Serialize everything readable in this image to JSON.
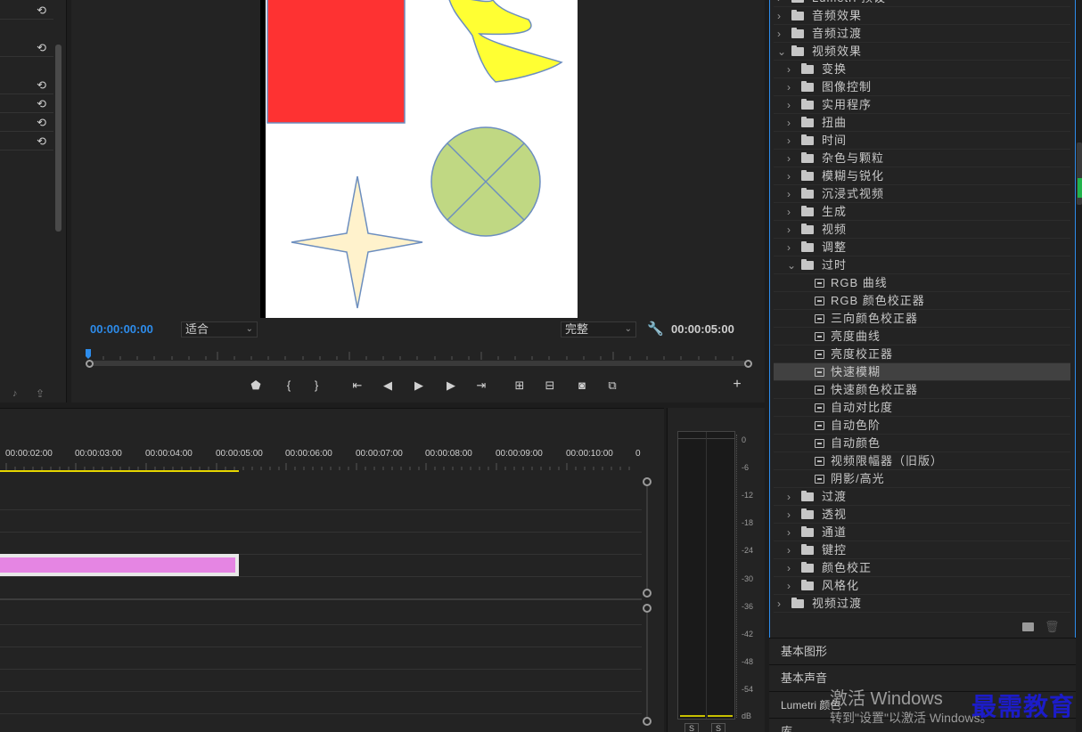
{
  "monitor": {
    "current_time": "00:00:00:00",
    "fit_select": "适合",
    "quality_select": "完整",
    "duration": "00:00:05:00"
  },
  "timeline": {
    "timecodes": [
      "00:00:02:00",
      "00:00:03:00",
      "00:00:04:00",
      "00:00:05:00",
      "00:00:06:00",
      "00:00:07:00",
      "00:00:08:00",
      "00:00:09:00",
      "00:00:10:00",
      "0"
    ]
  },
  "meter": {
    "scale": [
      "0",
      "-6",
      "-12",
      "-18",
      "-24",
      "-30",
      "-36",
      "-42",
      "-48",
      "-54",
      "dB"
    ],
    "solo": [
      "S",
      "S"
    ]
  },
  "effects": {
    "items": [
      {
        "label": "Lumetri 预设",
        "level": 0,
        "kind": "folder",
        "open": false
      },
      {
        "label": "音频效果",
        "level": 0,
        "kind": "folder",
        "open": false
      },
      {
        "label": "音频过渡",
        "level": 0,
        "kind": "folder",
        "open": false
      },
      {
        "label": "视频效果",
        "level": 0,
        "kind": "folder",
        "open": true
      },
      {
        "label": "变换",
        "level": 1,
        "kind": "folder",
        "open": false
      },
      {
        "label": "图像控制",
        "level": 1,
        "kind": "folder",
        "open": false
      },
      {
        "label": "实用程序",
        "level": 1,
        "kind": "folder",
        "open": false
      },
      {
        "label": "扭曲",
        "level": 1,
        "kind": "folder",
        "open": false
      },
      {
        "label": "时间",
        "level": 1,
        "kind": "folder",
        "open": false
      },
      {
        "label": "杂色与颗粒",
        "level": 1,
        "kind": "folder",
        "open": false
      },
      {
        "label": "模糊与锐化",
        "level": 1,
        "kind": "folder",
        "open": false
      },
      {
        "label": "沉浸式视频",
        "level": 1,
        "kind": "folder",
        "open": false
      },
      {
        "label": "生成",
        "level": 1,
        "kind": "folder",
        "open": false
      },
      {
        "label": "视频",
        "level": 1,
        "kind": "folder",
        "open": false
      },
      {
        "label": "调整",
        "level": 1,
        "kind": "folder",
        "open": false
      },
      {
        "label": "过时",
        "level": 1,
        "kind": "folder",
        "open": true
      },
      {
        "label": "RGB 曲线",
        "level": 2,
        "kind": "effect"
      },
      {
        "label": "RGB 颜色校正器",
        "level": 2,
        "kind": "effect"
      },
      {
        "label": "三向颜色校正器",
        "level": 2,
        "kind": "effect"
      },
      {
        "label": "亮度曲线",
        "level": 2,
        "kind": "effect"
      },
      {
        "label": "亮度校正器",
        "level": 2,
        "kind": "effect"
      },
      {
        "label": "快速模糊",
        "level": 2,
        "kind": "effect",
        "selected": true
      },
      {
        "label": "快速颜色校正器",
        "level": 2,
        "kind": "effect"
      },
      {
        "label": "自动对比度",
        "level": 2,
        "kind": "effect"
      },
      {
        "label": "自动色阶",
        "level": 2,
        "kind": "effect"
      },
      {
        "label": "自动颜色",
        "level": 2,
        "kind": "effect"
      },
      {
        "label": "视频限幅器（旧版）",
        "level": 2,
        "kind": "effect"
      },
      {
        "label": "阴影/高光",
        "level": 2,
        "kind": "effect"
      },
      {
        "label": "过渡",
        "level": 1,
        "kind": "folder",
        "open": false
      },
      {
        "label": "透视",
        "level": 1,
        "kind": "folder",
        "open": false
      },
      {
        "label": "通道",
        "level": 1,
        "kind": "folder",
        "open": false
      },
      {
        "label": "键控",
        "level": 1,
        "kind": "folder",
        "open": false
      },
      {
        "label": "颜色校正",
        "level": 1,
        "kind": "folder",
        "open": false
      },
      {
        "label": "风格化",
        "level": 1,
        "kind": "folder",
        "open": false
      },
      {
        "label": "视频过渡",
        "level": 0,
        "kind": "folder",
        "open": false
      }
    ]
  },
  "panels": {
    "essential_graphics": "基本图形",
    "essential_sound": "基本声音",
    "lumetri_color": "Lumetri 颜色",
    "library": "库"
  },
  "watermark": {
    "activate_title": "激活 Windows",
    "activate_sub": "转到\"设置\"以激活 Windows。",
    "brand": "最需教育"
  },
  "colors": {
    "accent_blue": "#2d8ceb",
    "clip_pink": "#e585e3",
    "playhead_yellow": "#e6d600"
  }
}
